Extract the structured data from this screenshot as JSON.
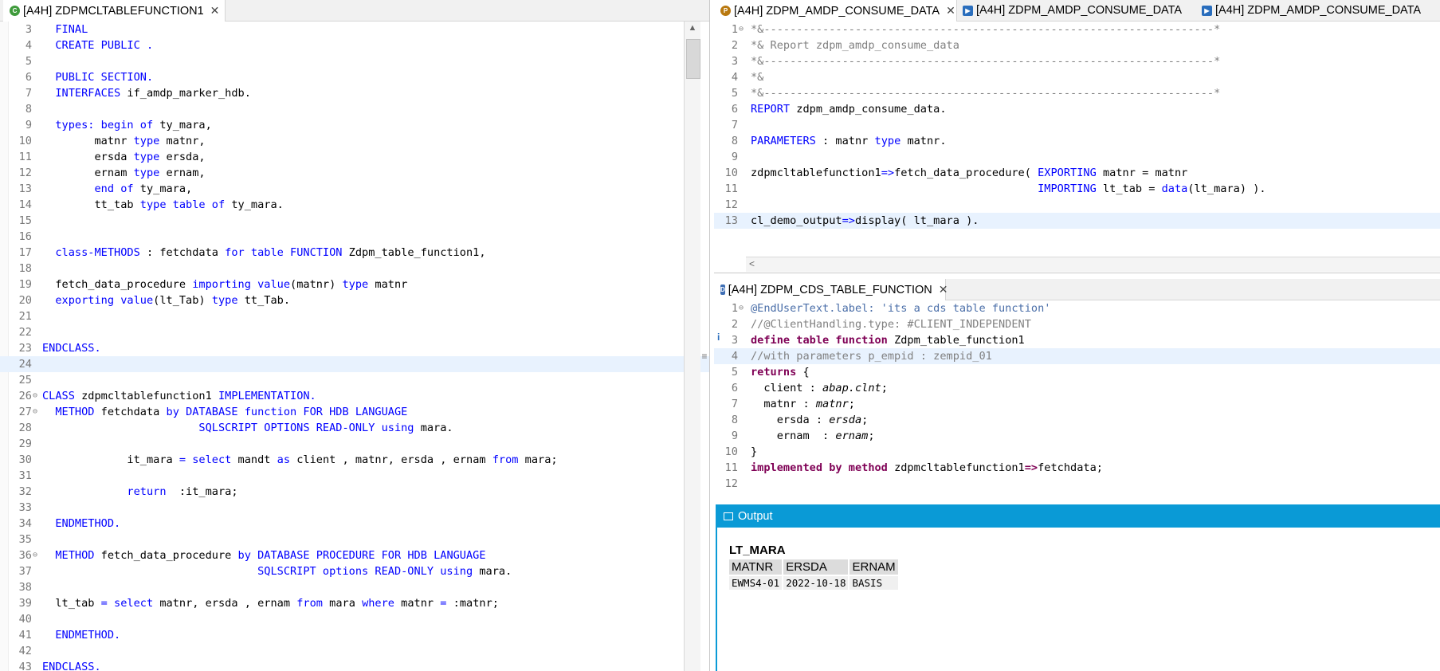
{
  "left_editor": {
    "tab_title": "[A4H] ZDPMCLTABLEFUNCTION1",
    "lines": [
      {
        "n": "3",
        "fold": "",
        "code": [
          [
            "kw",
            "  FINAL"
          ]
        ]
      },
      {
        "n": "4",
        "fold": "",
        "code": [
          [
            "kw",
            "  CREATE PUBLIC ."
          ]
        ]
      },
      {
        "n": "5",
        "fold": "",
        "code": []
      },
      {
        "n": "6",
        "fold": "",
        "code": [
          [
            "kw",
            "  PUBLIC SECTION."
          ]
        ]
      },
      {
        "n": "7",
        "fold": "",
        "code": [
          [
            "kw",
            "  INTERFACES "
          ],
          [
            "",
            "if_amdp_marker_hdb."
          ]
        ]
      },
      {
        "n": "8",
        "fold": "",
        "code": []
      },
      {
        "n": "9",
        "fold": "",
        "code": [
          [
            "kw",
            "  types: begin of "
          ],
          [
            "",
            "ty_mara,"
          ]
        ]
      },
      {
        "n": "10",
        "fold": "",
        "code": [
          [
            "",
            "        matnr "
          ],
          [
            "kw",
            "type "
          ],
          [
            "",
            "matnr,"
          ]
        ]
      },
      {
        "n": "11",
        "fold": "",
        "code": [
          [
            "",
            "        ersda "
          ],
          [
            "kw",
            "type "
          ],
          [
            "",
            "ersda,"
          ]
        ]
      },
      {
        "n": "12",
        "fold": "",
        "code": [
          [
            "",
            "        ernam "
          ],
          [
            "kw",
            "type "
          ],
          [
            "",
            "ernam,"
          ]
        ]
      },
      {
        "n": "13",
        "fold": "",
        "code": [
          [
            "kw",
            "        end of "
          ],
          [
            "",
            "ty_mara,"
          ]
        ]
      },
      {
        "n": "14",
        "fold": "",
        "code": [
          [
            "",
            "        tt_tab "
          ],
          [
            "kw",
            "type table of "
          ],
          [
            "",
            "ty_mara."
          ]
        ]
      },
      {
        "n": "15",
        "fold": "",
        "code": []
      },
      {
        "n": "16",
        "fold": "",
        "code": []
      },
      {
        "n": "17",
        "fold": "",
        "code": [
          [
            "kw",
            "  class-METHODS "
          ],
          [
            "",
            ": fetchdata "
          ],
          [
            "kw",
            "for table FUNCTION "
          ],
          [
            "",
            "Zdpm_table_function1,"
          ]
        ]
      },
      {
        "n": "18",
        "fold": "",
        "code": []
      },
      {
        "n": "19",
        "fold": "",
        "code": [
          [
            "",
            "  fetch_data_procedure "
          ],
          [
            "kw",
            "importing value"
          ],
          [
            "",
            "(matnr) "
          ],
          [
            "kw",
            "type "
          ],
          [
            "",
            "matnr"
          ]
        ]
      },
      {
        "n": "20",
        "fold": "",
        "code": [
          [
            "kw",
            "  exporting value"
          ],
          [
            "",
            "(lt_Tab) "
          ],
          [
            "kw",
            "type "
          ],
          [
            "",
            "tt_Tab."
          ]
        ]
      },
      {
        "n": "21",
        "fold": "",
        "code": []
      },
      {
        "n": "22",
        "fold": "",
        "code": []
      },
      {
        "n": "23",
        "fold": "",
        "code": [
          [
            "kw",
            "ENDCLASS."
          ]
        ]
      },
      {
        "n": "24",
        "fold": "",
        "code": [],
        "hl": true
      },
      {
        "n": "25",
        "fold": "",
        "code": []
      },
      {
        "n": "26",
        "fold": "⊖",
        "code": [
          [
            "kw",
            "CLASS "
          ],
          [
            "",
            "zdpmcltablefunction1 "
          ],
          [
            "kw",
            "IMPLEMENTATION."
          ]
        ]
      },
      {
        "n": "27",
        "fold": "⊖",
        "code": [
          [
            "kw",
            "  METHOD "
          ],
          [
            "",
            "fetchdata "
          ],
          [
            "kw",
            "by DATABASE function FOR HDB LANGUAGE"
          ]
        ]
      },
      {
        "n": "28",
        "fold": "",
        "code": [
          [
            "kw",
            "                        SQLSCRIPT OPTIONS READ-ONLY using "
          ],
          [
            "",
            "mara."
          ]
        ]
      },
      {
        "n": "29",
        "fold": "",
        "code": []
      },
      {
        "n": "30",
        "fold": "",
        "code": [
          [
            "",
            "             it_mara "
          ],
          [
            "kw",
            "= select "
          ],
          [
            "",
            "mandt "
          ],
          [
            "kw",
            "as "
          ],
          [
            "",
            "client , matnr, ersda , ernam "
          ],
          [
            "kw",
            "from "
          ],
          [
            "",
            "mara;"
          ]
        ]
      },
      {
        "n": "31",
        "fold": "",
        "code": []
      },
      {
        "n": "32",
        "fold": "",
        "code": [
          [
            "kw",
            "             return  "
          ],
          [
            "",
            ":it_mara;"
          ]
        ]
      },
      {
        "n": "33",
        "fold": "",
        "code": []
      },
      {
        "n": "34",
        "fold": "",
        "code": [
          [
            "kw",
            "  ENDMETHOD."
          ]
        ]
      },
      {
        "n": "35",
        "fold": "",
        "code": []
      },
      {
        "n": "36",
        "fold": "⊖",
        "code": [
          [
            "kw",
            "  METHOD "
          ],
          [
            "",
            "fetch_data_procedure "
          ],
          [
            "kw",
            "by DATABASE PROCEDURE FOR HDB LANGUAGE"
          ]
        ]
      },
      {
        "n": "37",
        "fold": "",
        "code": [
          [
            "kw",
            "                                 SQLSCRIPT options READ-ONLY using "
          ],
          [
            "",
            "mara."
          ]
        ]
      },
      {
        "n": "38",
        "fold": "",
        "code": []
      },
      {
        "n": "39",
        "fold": "",
        "code": [
          [
            "",
            "  lt_tab "
          ],
          [
            "kw",
            "= select "
          ],
          [
            "",
            "matnr, ersda , ernam "
          ],
          [
            "kw",
            "from "
          ],
          [
            "",
            "mara "
          ],
          [
            "kw",
            "where "
          ],
          [
            "",
            "matnr "
          ],
          [
            "kw",
            "= "
          ],
          [
            "",
            ":matnr;"
          ]
        ]
      },
      {
        "n": "40",
        "fold": "",
        "code": []
      },
      {
        "n": "41",
        "fold": "",
        "code": [
          [
            "kw",
            "  ENDMETHOD."
          ]
        ]
      },
      {
        "n": "42",
        "fold": "",
        "code": []
      },
      {
        "n": "43",
        "fold": "",
        "code": [
          [
            "kw",
            "ENDCLASS."
          ]
        ]
      }
    ]
  },
  "right_top_editor": {
    "tabs": [
      {
        "title": "[A4H] ZDPM_AMDP_CONSUME_DATA",
        "active": true,
        "icon": "P",
        "color": "#b9790f"
      },
      {
        "title": "[A4H] ZDPM_AMDP_CONSUME_DATA",
        "active": false,
        "icon": "run-program-icon",
        "color": "#2a6ebd"
      },
      {
        "title": "[A4H] ZDPM_AMDP_CONSUME_DATA",
        "active": false,
        "icon": "run-program-icon",
        "color": "#2a6ebd"
      }
    ],
    "lines": [
      {
        "n": "1",
        "fold": "⊖",
        "code": [
          [
            "cm",
            "*&---------------------------------------------------------------------*"
          ]
        ]
      },
      {
        "n": "2",
        "fold": "",
        "code": [
          [
            "cm",
            "*& Report zdpm_amdp_consume_data"
          ]
        ]
      },
      {
        "n": "3",
        "fold": "",
        "code": [
          [
            "cm",
            "*&---------------------------------------------------------------------*"
          ]
        ]
      },
      {
        "n": "4",
        "fold": "",
        "code": [
          [
            "cm",
            "*&"
          ]
        ]
      },
      {
        "n": "5",
        "fold": "",
        "code": [
          [
            "cm",
            "*&---------------------------------------------------------------------*"
          ]
        ]
      },
      {
        "n": "6",
        "fold": "",
        "code": [
          [
            "kw",
            "REPORT "
          ],
          [
            "",
            "zdpm_amdp_consume_data."
          ]
        ]
      },
      {
        "n": "7",
        "fold": "",
        "code": []
      },
      {
        "n": "8",
        "fold": "",
        "code": [
          [
            "kw",
            "PARAMETERS "
          ],
          [
            "",
            ": matnr "
          ],
          [
            "kw",
            "type "
          ],
          [
            "",
            "matnr."
          ]
        ]
      },
      {
        "n": "9",
        "fold": "",
        "code": []
      },
      {
        "n": "10",
        "fold": "",
        "code": [
          [
            "",
            "zdpmcltablefunction1"
          ],
          [
            "kw",
            "=>"
          ],
          [
            "",
            "fetch_data_procedure( "
          ],
          [
            "kw",
            "EXPORTING "
          ],
          [
            "",
            "matnr = matnr"
          ]
        ]
      },
      {
        "n": "11",
        "fold": "",
        "code": [
          [
            "kw",
            "                                            IMPORTING "
          ],
          [
            "",
            "lt_tab = "
          ],
          [
            "kw",
            "data"
          ],
          [
            "",
            "(lt_mara) )."
          ]
        ]
      },
      {
        "n": "12",
        "fold": "",
        "code": []
      },
      {
        "n": "13",
        "fold": "",
        "code": [
          [
            "",
            "cl_demo_output"
          ],
          [
            "kw",
            "=>"
          ],
          [
            "",
            "display( lt_mara )."
          ]
        ],
        "hl": true
      }
    ]
  },
  "right_mid_editor": {
    "tab_title": "[A4H] ZDPM_CDS_TABLE_FUNCTION",
    "lines": [
      {
        "n": "1",
        "fold": "⊖",
        "code": [
          [
            "st",
            "@EndUserText.label: 'its a cds table function'"
          ]
        ]
      },
      {
        "n": "2",
        "fold": "",
        "code": [
          [
            "cm",
            "//@ClientHandling.type: #CLIENT_INDEPENDENT"
          ]
        ]
      },
      {
        "n": "3",
        "fold": "",
        "code": [
          [
            "kb",
            "define table function "
          ],
          [
            "",
            "Zdpm_table_function1"
          ]
        ]
      },
      {
        "n": "4",
        "fold": "",
        "code": [
          [
            "cm",
            "//with parameters p_empid : zempid_01"
          ]
        ],
        "hl": true
      },
      {
        "n": "5",
        "fold": "",
        "code": [
          [
            "kb",
            "returns "
          ],
          [
            "",
            "{"
          ]
        ]
      },
      {
        "n": "6",
        "fold": "",
        "code": [
          [
            "",
            "  client : "
          ],
          [
            "it",
            "abap.clnt"
          ],
          [
            "",
            ";"
          ]
        ]
      },
      {
        "n": "7",
        "fold": "",
        "code": [
          [
            "",
            "  matnr : "
          ],
          [
            "it",
            "matnr"
          ],
          [
            "",
            ";"
          ]
        ]
      },
      {
        "n": "8",
        "fold": "",
        "code": [
          [
            "",
            "    ersda : "
          ],
          [
            "it",
            "ersda"
          ],
          [
            "",
            ";"
          ]
        ]
      },
      {
        "n": "9",
        "fold": "",
        "code": [
          [
            "",
            "    ernam  : "
          ],
          [
            "it",
            "ernam"
          ],
          [
            "",
            ";"
          ]
        ]
      },
      {
        "n": "10",
        "fold": "",
        "code": [
          [
            "",
            "}"
          ]
        ]
      },
      {
        "n": "11",
        "fold": "",
        "code": [
          [
            "kb",
            "implemented by method "
          ],
          [
            "",
            "zdpmcltablefunction1"
          ],
          [
            "kb",
            "=>"
          ],
          [
            "",
            "fetchdata;"
          ]
        ]
      },
      {
        "n": "12",
        "fold": "",
        "code": []
      }
    ]
  },
  "output": {
    "title": "Output",
    "table_name": "LT_MARA",
    "columns": [
      "MATNR",
      "ERSDA",
      "ERNAM"
    ],
    "rows": [
      [
        "EWMS4-01",
        "2022-10-18",
        "BASIS"
      ]
    ]
  }
}
